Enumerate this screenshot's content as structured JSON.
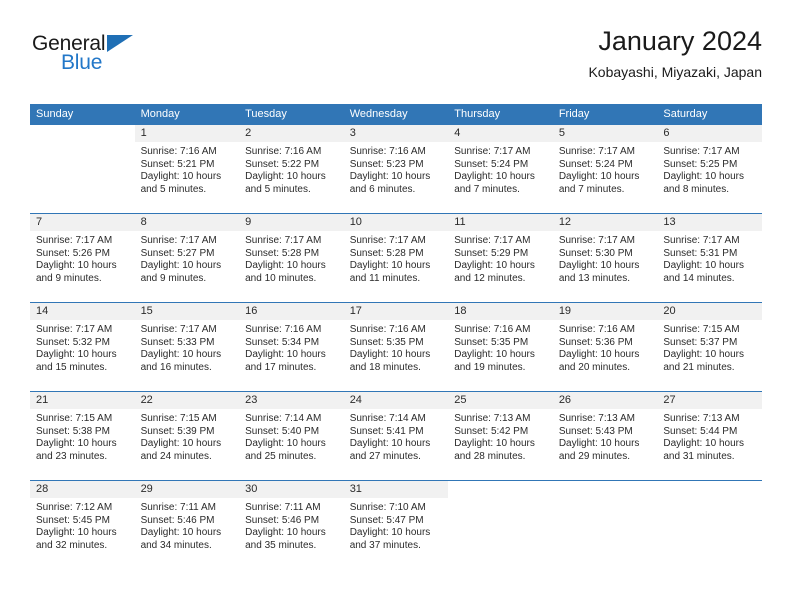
{
  "brand": {
    "name_part1": "General",
    "name_part2": "Blue",
    "triangle_icon": "triangle-icon",
    "accent_color": "#1f6fb5",
    "blue_text_color": "#2277c8"
  },
  "header": {
    "title": "January 2024",
    "subtitle": "Kobayashi, Miyazaki, Japan",
    "header_bg_color": "#3176b6",
    "header_text_color": "#ffffff",
    "daynum_band_color": "#f1f1f1"
  },
  "weekday_headers": [
    "Sunday",
    "Monday",
    "Tuesday",
    "Wednesday",
    "Thursday",
    "Friday",
    "Saturday"
  ],
  "weeks": [
    [
      {
        "day": "",
        "sunrise": "",
        "sunset": "",
        "daylight_line1": "",
        "daylight_line2": "",
        "blank": true
      },
      {
        "day": "1",
        "sunrise": "Sunrise: 7:16 AM",
        "sunset": "Sunset: 5:21 PM",
        "daylight_line1": "Daylight: 10 hours",
        "daylight_line2": "and 5 minutes."
      },
      {
        "day": "2",
        "sunrise": "Sunrise: 7:16 AM",
        "sunset": "Sunset: 5:22 PM",
        "daylight_line1": "Daylight: 10 hours",
        "daylight_line2": "and 5 minutes."
      },
      {
        "day": "3",
        "sunrise": "Sunrise: 7:16 AM",
        "sunset": "Sunset: 5:23 PM",
        "daylight_line1": "Daylight: 10 hours",
        "daylight_line2": "and 6 minutes."
      },
      {
        "day": "4",
        "sunrise": "Sunrise: 7:17 AM",
        "sunset": "Sunset: 5:24 PM",
        "daylight_line1": "Daylight: 10 hours",
        "daylight_line2": "and 7 minutes."
      },
      {
        "day": "5",
        "sunrise": "Sunrise: 7:17 AM",
        "sunset": "Sunset: 5:24 PM",
        "daylight_line1": "Daylight: 10 hours",
        "daylight_line2": "and 7 minutes."
      },
      {
        "day": "6",
        "sunrise": "Sunrise: 7:17 AM",
        "sunset": "Sunset: 5:25 PM",
        "daylight_line1": "Daylight: 10 hours",
        "daylight_line2": "and 8 minutes."
      }
    ],
    [
      {
        "day": "7",
        "sunrise": "Sunrise: 7:17 AM",
        "sunset": "Sunset: 5:26 PM",
        "daylight_line1": "Daylight: 10 hours",
        "daylight_line2": "and 9 minutes."
      },
      {
        "day": "8",
        "sunrise": "Sunrise: 7:17 AM",
        "sunset": "Sunset: 5:27 PM",
        "daylight_line1": "Daylight: 10 hours",
        "daylight_line2": "and 9 minutes."
      },
      {
        "day": "9",
        "sunrise": "Sunrise: 7:17 AM",
        "sunset": "Sunset: 5:28 PM",
        "daylight_line1": "Daylight: 10 hours",
        "daylight_line2": "and 10 minutes."
      },
      {
        "day": "10",
        "sunrise": "Sunrise: 7:17 AM",
        "sunset": "Sunset: 5:28 PM",
        "daylight_line1": "Daylight: 10 hours",
        "daylight_line2": "and 11 minutes."
      },
      {
        "day": "11",
        "sunrise": "Sunrise: 7:17 AM",
        "sunset": "Sunset: 5:29 PM",
        "daylight_line1": "Daylight: 10 hours",
        "daylight_line2": "and 12 minutes."
      },
      {
        "day": "12",
        "sunrise": "Sunrise: 7:17 AM",
        "sunset": "Sunset: 5:30 PM",
        "daylight_line1": "Daylight: 10 hours",
        "daylight_line2": "and 13 minutes."
      },
      {
        "day": "13",
        "sunrise": "Sunrise: 7:17 AM",
        "sunset": "Sunset: 5:31 PM",
        "daylight_line1": "Daylight: 10 hours",
        "daylight_line2": "and 14 minutes."
      }
    ],
    [
      {
        "day": "14",
        "sunrise": "Sunrise: 7:17 AM",
        "sunset": "Sunset: 5:32 PM",
        "daylight_line1": "Daylight: 10 hours",
        "daylight_line2": "and 15 minutes."
      },
      {
        "day": "15",
        "sunrise": "Sunrise: 7:17 AM",
        "sunset": "Sunset: 5:33 PM",
        "daylight_line1": "Daylight: 10 hours",
        "daylight_line2": "and 16 minutes."
      },
      {
        "day": "16",
        "sunrise": "Sunrise: 7:16 AM",
        "sunset": "Sunset: 5:34 PM",
        "daylight_line1": "Daylight: 10 hours",
        "daylight_line2": "and 17 minutes."
      },
      {
        "day": "17",
        "sunrise": "Sunrise: 7:16 AM",
        "sunset": "Sunset: 5:35 PM",
        "daylight_line1": "Daylight: 10 hours",
        "daylight_line2": "and 18 minutes."
      },
      {
        "day": "18",
        "sunrise": "Sunrise: 7:16 AM",
        "sunset": "Sunset: 5:35 PM",
        "daylight_line1": "Daylight: 10 hours",
        "daylight_line2": "and 19 minutes."
      },
      {
        "day": "19",
        "sunrise": "Sunrise: 7:16 AM",
        "sunset": "Sunset: 5:36 PM",
        "daylight_line1": "Daylight: 10 hours",
        "daylight_line2": "and 20 minutes."
      },
      {
        "day": "20",
        "sunrise": "Sunrise: 7:15 AM",
        "sunset": "Sunset: 5:37 PM",
        "daylight_line1": "Daylight: 10 hours",
        "daylight_line2": "and 21 minutes."
      }
    ],
    [
      {
        "day": "21",
        "sunrise": "Sunrise: 7:15 AM",
        "sunset": "Sunset: 5:38 PM",
        "daylight_line1": "Daylight: 10 hours",
        "daylight_line2": "and 23 minutes."
      },
      {
        "day": "22",
        "sunrise": "Sunrise: 7:15 AM",
        "sunset": "Sunset: 5:39 PM",
        "daylight_line1": "Daylight: 10 hours",
        "daylight_line2": "and 24 minutes."
      },
      {
        "day": "23",
        "sunrise": "Sunrise: 7:14 AM",
        "sunset": "Sunset: 5:40 PM",
        "daylight_line1": "Daylight: 10 hours",
        "daylight_line2": "and 25 minutes."
      },
      {
        "day": "24",
        "sunrise": "Sunrise: 7:14 AM",
        "sunset": "Sunset: 5:41 PM",
        "daylight_line1": "Daylight: 10 hours",
        "daylight_line2": "and 27 minutes."
      },
      {
        "day": "25",
        "sunrise": "Sunrise: 7:13 AM",
        "sunset": "Sunset: 5:42 PM",
        "daylight_line1": "Daylight: 10 hours",
        "daylight_line2": "and 28 minutes."
      },
      {
        "day": "26",
        "sunrise": "Sunrise: 7:13 AM",
        "sunset": "Sunset: 5:43 PM",
        "daylight_line1": "Daylight: 10 hours",
        "daylight_line2": "and 29 minutes."
      },
      {
        "day": "27",
        "sunrise": "Sunrise: 7:13 AM",
        "sunset": "Sunset: 5:44 PM",
        "daylight_line1": "Daylight: 10 hours",
        "daylight_line2": "and 31 minutes."
      }
    ],
    [
      {
        "day": "28",
        "sunrise": "Sunrise: 7:12 AM",
        "sunset": "Sunset: 5:45 PM",
        "daylight_line1": "Daylight: 10 hours",
        "daylight_line2": "and 32 minutes."
      },
      {
        "day": "29",
        "sunrise": "Sunrise: 7:11 AM",
        "sunset": "Sunset: 5:46 PM",
        "daylight_line1": "Daylight: 10 hours",
        "daylight_line2": "and 34 minutes."
      },
      {
        "day": "30",
        "sunrise": "Sunrise: 7:11 AM",
        "sunset": "Sunset: 5:46 PM",
        "daylight_line1": "Daylight: 10 hours",
        "daylight_line2": "and 35 minutes."
      },
      {
        "day": "31",
        "sunrise": "Sunrise: 7:10 AM",
        "sunset": "Sunset: 5:47 PM",
        "daylight_line1": "Daylight: 10 hours",
        "daylight_line2": "and 37 minutes."
      },
      {
        "day": "",
        "sunrise": "",
        "sunset": "",
        "daylight_line1": "",
        "daylight_line2": "",
        "blank": true
      },
      {
        "day": "",
        "sunrise": "",
        "sunset": "",
        "daylight_line1": "",
        "daylight_line2": "",
        "blank": true
      },
      {
        "day": "",
        "sunrise": "",
        "sunset": "",
        "daylight_line1": "",
        "daylight_line2": "",
        "blank": true
      }
    ]
  ]
}
